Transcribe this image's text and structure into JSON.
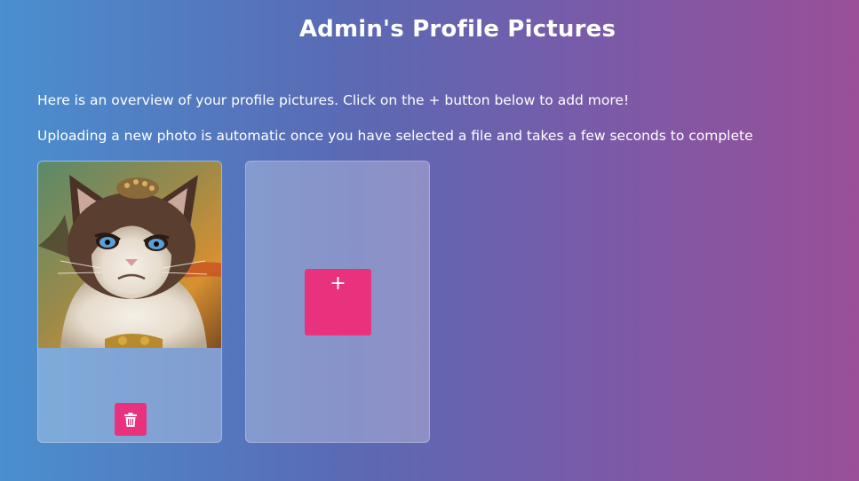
{
  "page": {
    "title": "Admin's Profile Pictures",
    "intro_line_1": "Here is an overview of your profile pictures. Click on the + button below to add more!",
    "intro_line_2": "Uploading a new photo is automatic once you have selected a file and takes a few seconds to complete"
  },
  "pictures": [
    {
      "alt": "Profile picture",
      "delete_icon": "trash-icon"
    }
  ],
  "add_card": {
    "button_label": "+",
    "icon": "plus-icon"
  },
  "colors": {
    "accent": "#e8327e",
    "background_start": "#4a8fcf",
    "background_end": "#9a4f98"
  }
}
